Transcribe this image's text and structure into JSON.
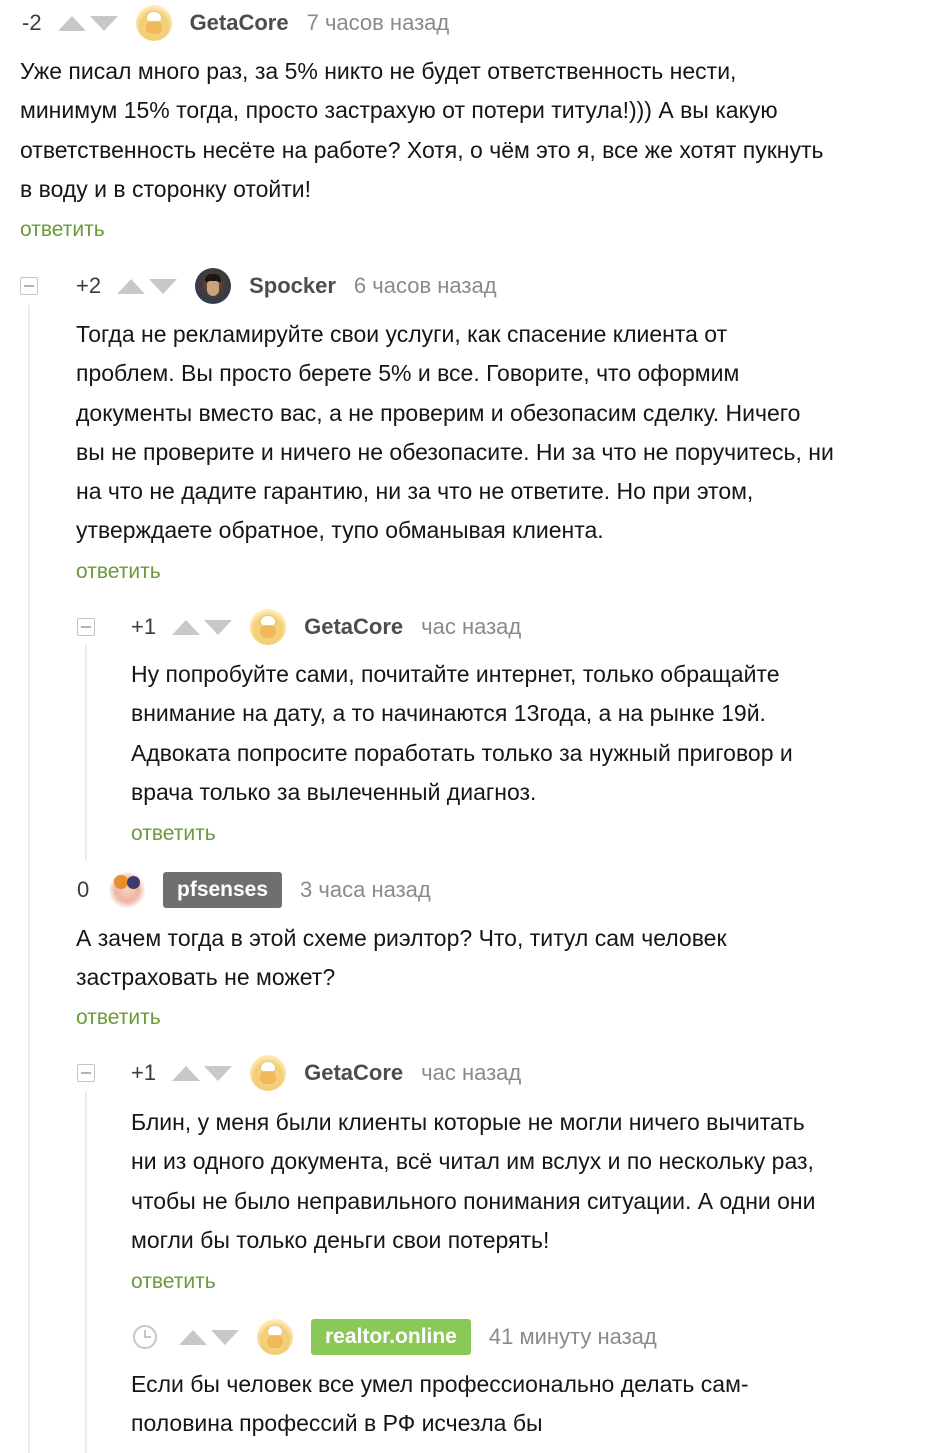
{
  "theme": {
    "reply_color": "#6a9a3a",
    "pfsenses_badge_color": "#6f6f6f",
    "realtor_badge_color": "#8ac858"
  },
  "comments": [
    {
      "rating": "-2",
      "author": "GetaCore",
      "time": "7 часов назад",
      "avatar": "default-avatar-icon",
      "text": "Уже писал много раз, за 5% никто не будет ответственность нести,\nминимум 15% тогда, просто застрахую от потери титула!))) А вы какую\nответственность несёте на работе? Хотя, о чём это я, все же хотят пукнуть\nв воду и в сторонку отойти!",
      "reply_label": "ответить"
    },
    {
      "rating": "+2",
      "author": "Spocker",
      "time": "6 часов назад",
      "avatar": "spocker-avatar-icon",
      "text": "Тогда не рекламируйте свои услуги, как спасение клиента от\nпроблем. Вы просто берете 5% и все. Говорите, что оформим\nдокументы вместо вас, а не проверим и обезопасим сделку. Ничего\nвы не проверите и ничего не обезопасите. Ни за что не поручитесь, ни\nна что не дадите гарантию, ни за что не ответите. Но при этом,\nутверждаете обратное, тупо обманывая клиента.",
      "reply_label": "ответить"
    },
    {
      "rating": "+1",
      "author": "GetaCore",
      "time": "час назад",
      "avatar": "default-avatar-icon",
      "text": "Ну попробуйте сами, почитайте интернет, только обращайте\nвнимание на дату, а то начинаются 13года, а на рынке 19й.\nАдвоката попросите поработать только за нужный приговор и\nврача только за вылеченный диагноз.",
      "reply_label": "ответить"
    },
    {
      "rating": "0",
      "author": "pfsenses",
      "time": "3 часа назад",
      "avatar": "pfsenses-avatar-icon",
      "text": "А зачем тогда в этой схеме риэлтор? Что, титул сам человек\nзастраховать не может?",
      "reply_label": "ответить"
    },
    {
      "rating": "+1",
      "author": "GetaCore",
      "time": "час назад",
      "avatar": "default-avatar-icon",
      "text": "Блин, у меня были клиенты которые не могли ничего вычитать\nни из одного документа, всё читал им вслух и по нескольку раз,\nчтобы не было неправильного понимания ситуации. А одни они\nмогли бы только деньги свои потерять!",
      "reply_label": "ответить"
    },
    {
      "rating_icon": "clock-icon",
      "author": "realtor.online",
      "time": "41 минуту назад",
      "avatar": "default-avatar-icon",
      "text": "Если бы человек все умел профессионально делать сам-\nполовина профессий в РФ исчезла бы"
    }
  ]
}
